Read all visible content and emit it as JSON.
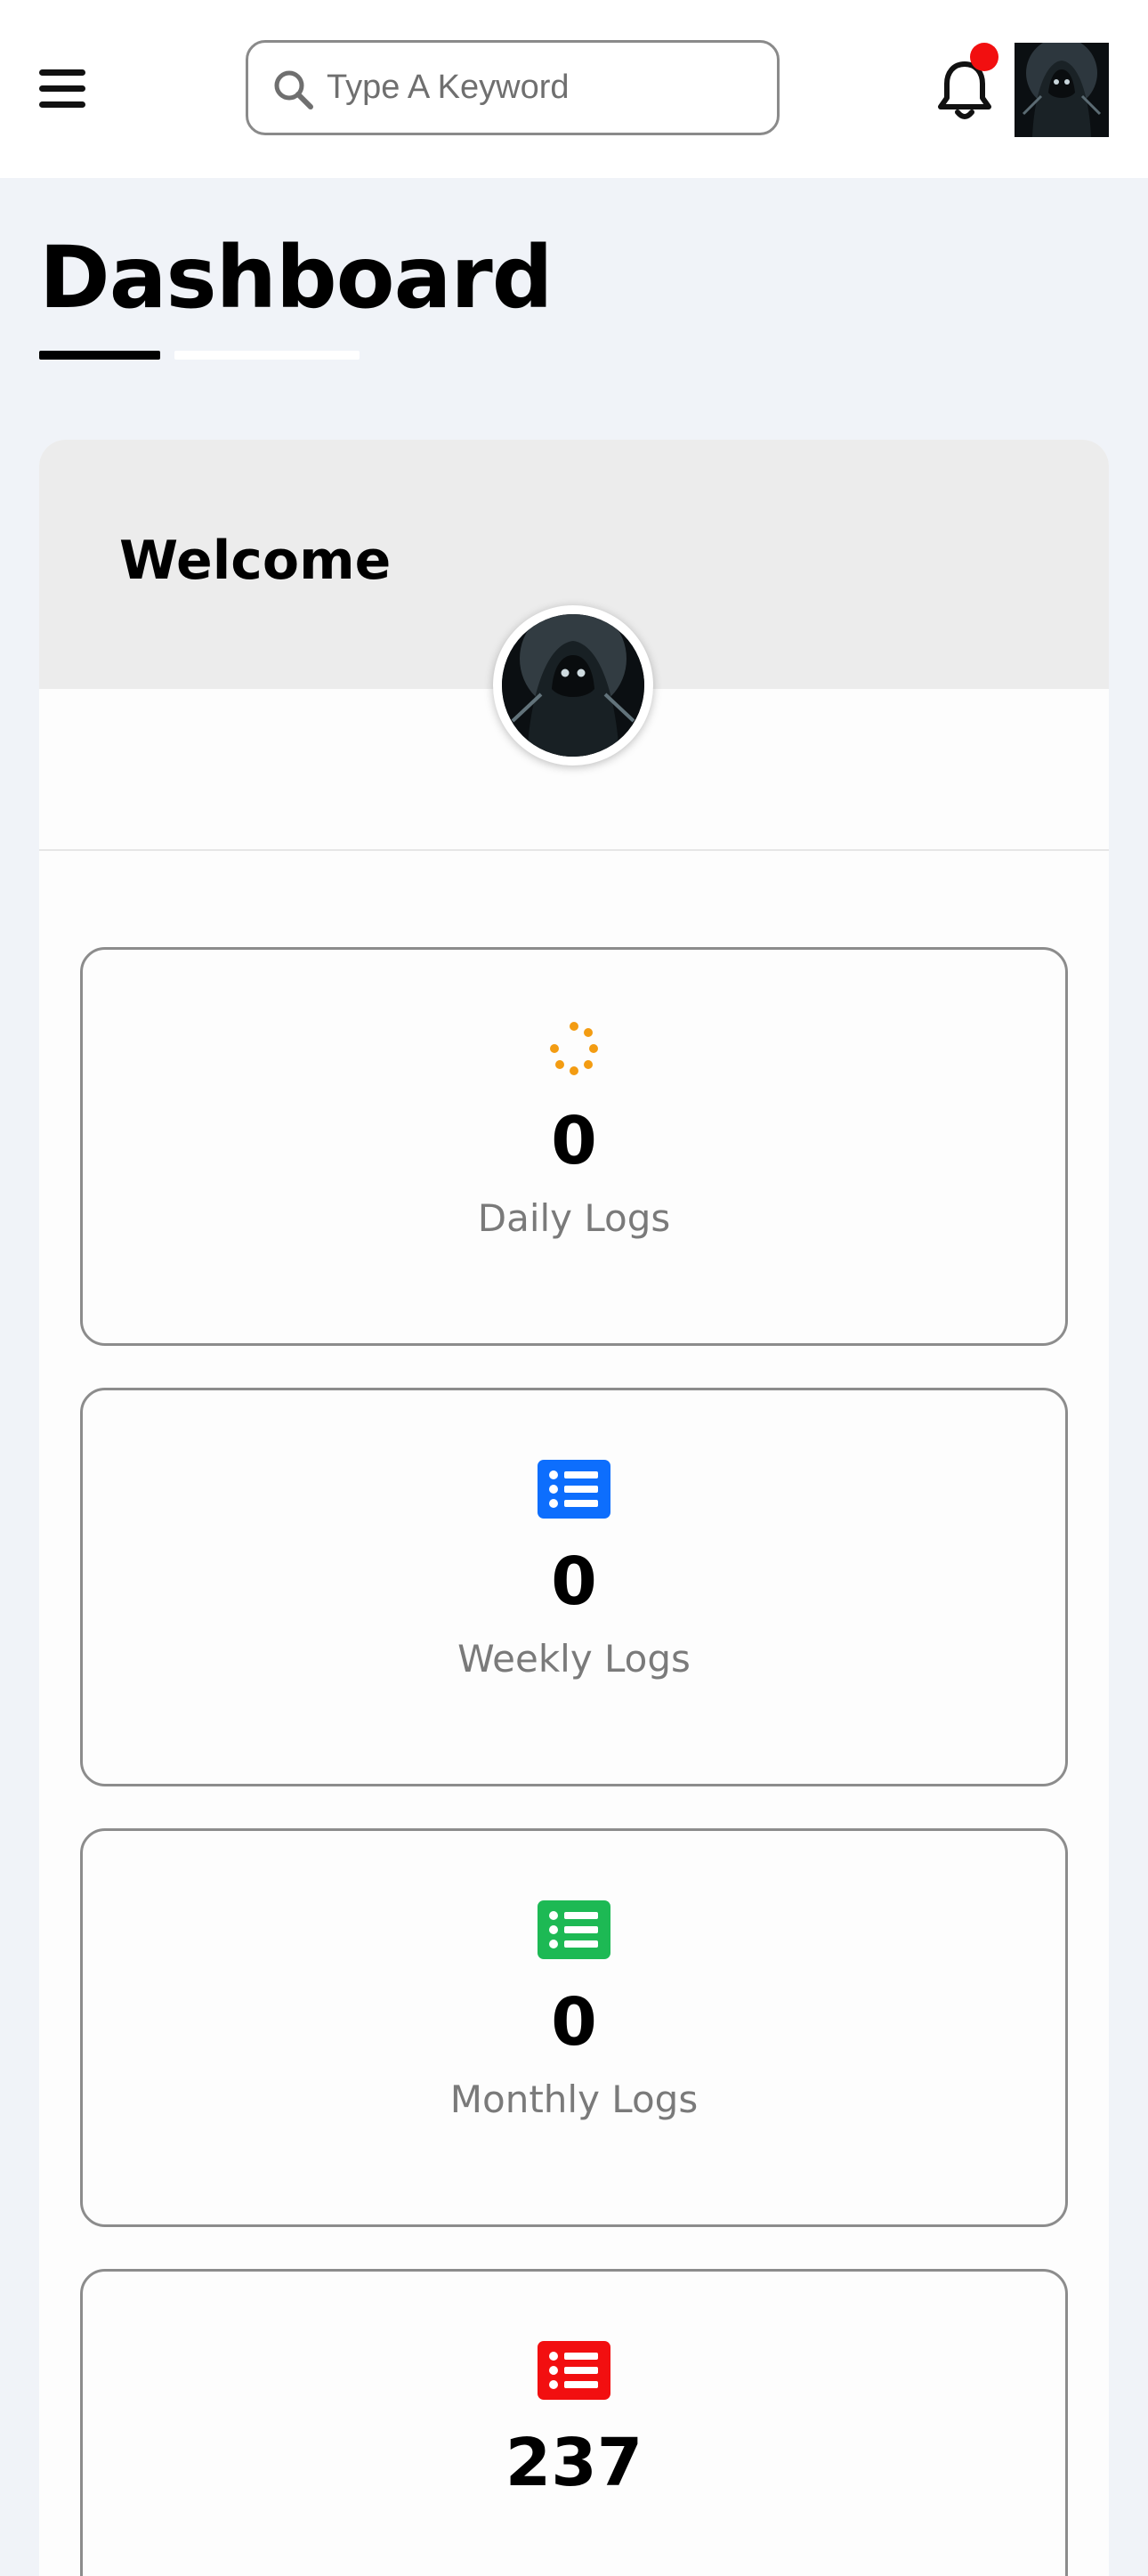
{
  "header": {
    "search": {
      "placeholder": "Type A Keyword",
      "value": ""
    },
    "notification_indicator_color": "#f20f10",
    "icons": [
      "menu-icon",
      "search-icon",
      "bell-icon",
      "user-avatar"
    ]
  },
  "page": {
    "title": "Dashboard"
  },
  "welcome": {
    "greeting": "Welcome"
  },
  "stats": [
    {
      "value": "0",
      "label": "Daily Logs",
      "icon": "loading-spinner-icon",
      "color": "#f39c12"
    },
    {
      "value": "0",
      "label": "Weekly Logs",
      "icon": "list-icon",
      "color": "#0d6efd"
    },
    {
      "value": "0",
      "label": "Monthly Logs",
      "icon": "list-icon",
      "color": "#1db954"
    },
    {
      "value": "237",
      "label": "",
      "icon": "list-icon",
      "color": "#f20f10"
    }
  ],
  "colors": {
    "background": "#f0f3f8",
    "card_border": "#8c8c8c",
    "label_gray": "#7a7a7a"
  }
}
